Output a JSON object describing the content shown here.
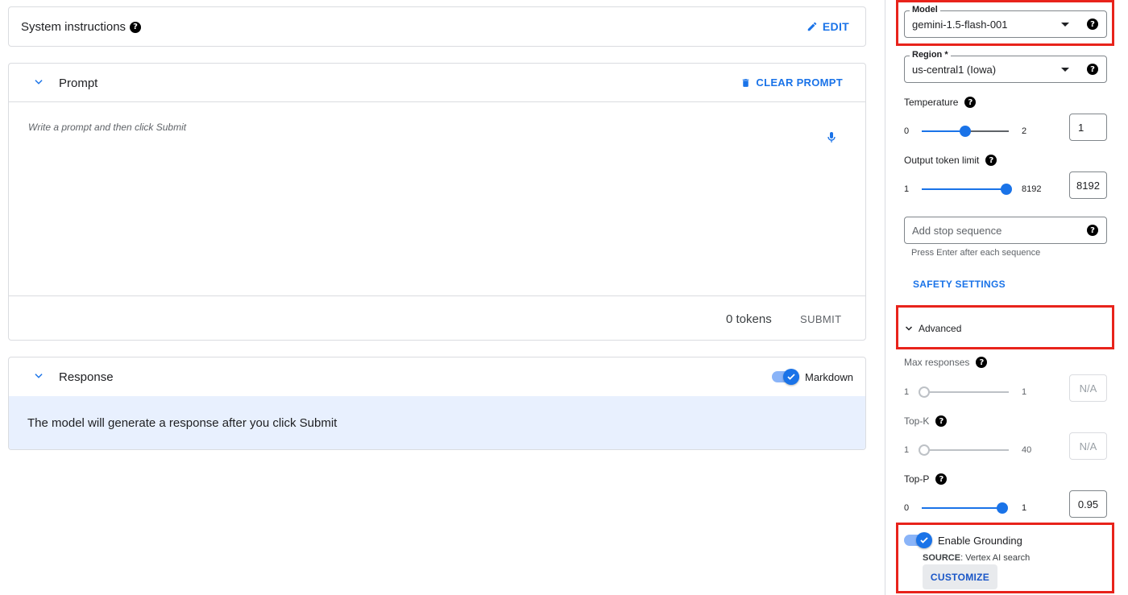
{
  "system_instructions": {
    "title": "System instructions",
    "edit_label": "EDIT"
  },
  "prompt": {
    "title": "Prompt",
    "clear_label": "CLEAR PROMPT",
    "placeholder": "Write a prompt and then click Submit",
    "tokens": "0 tokens",
    "submit_label": "SUBMIT"
  },
  "response": {
    "title": "Response",
    "markdown_label": "Markdown",
    "markdown_enabled": true,
    "body_text": "The model will generate a response after you click Submit"
  },
  "settings": {
    "model": {
      "label": "Model",
      "value": "gemini-1.5-flash-001"
    },
    "region": {
      "label": "Region *",
      "value": "us-central1 (Iowa)"
    },
    "temperature": {
      "label": "Temperature",
      "min": "0",
      "max": "2",
      "value": "1",
      "fraction": 0.5
    },
    "output_token_limit": {
      "label": "Output token limit",
      "min": "1",
      "max": "8192",
      "value": "8192",
      "fraction": 1.0
    },
    "stop_sequence": {
      "placeholder": "Add stop sequence",
      "hint": "Press Enter after each sequence"
    },
    "safety_label": "SAFETY SETTINGS",
    "advanced_label": "Advanced",
    "max_responses": {
      "label": "Max responses",
      "min": "1",
      "max": "1",
      "value": "N/A",
      "fraction": 0.0
    },
    "top_k": {
      "label": "Top-K",
      "min": "1",
      "max": "40",
      "value": "N/A",
      "fraction": 0.0
    },
    "top_p": {
      "label": "Top-P",
      "min": "0",
      "max": "1",
      "value": "0.95",
      "fraction": 0.95
    },
    "grounding": {
      "label": "Enable Grounding",
      "enabled": true,
      "source_key": "SOURCE",
      "source_value": ": Vertex AI search",
      "customize_label": "CUSTOMIZE"
    }
  },
  "colors": {
    "accent": "#1a73e8",
    "highlight": "#e8231b",
    "response_bg": "#e8f0fe"
  }
}
